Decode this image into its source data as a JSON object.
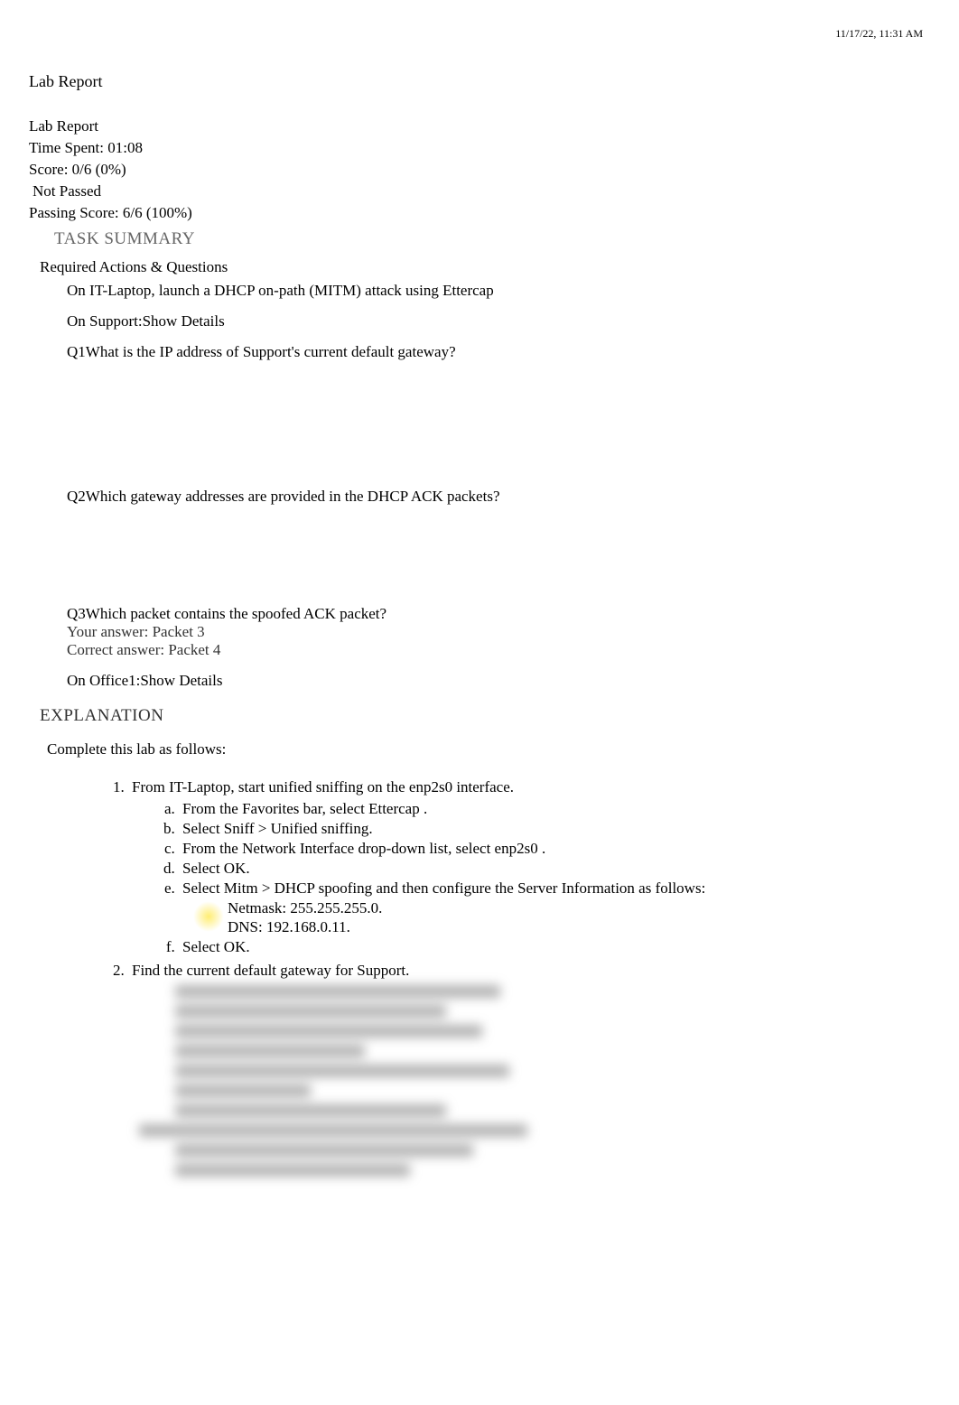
{
  "header": {
    "timestamp": "11/17/22, 11:31 AM"
  },
  "title": "Lab Report",
  "meta": {
    "report_label": "Lab Report",
    "time_spent": "Time Spent: 01:08",
    "score": "Score: 0/6 (0%)",
    "status": "Not Passed",
    "passing_score": "Passing Score: 6/6 (100%)"
  },
  "task_summary_heading": "TASK SUMMARY",
  "required_heading": "Required Actions & Questions",
  "tasks": {
    "t1": "On IT-Laptop, launch a DHCP on-path (MITM) attack using Ettercap",
    "t2": "On Support:Show Details",
    "q1_label": "Q1",
    "q1_text": "What is the IP address of Support's current default gateway?",
    "q2_label": "Q2",
    "q2_text": "Which gateway addresses are provided in the DHCP ACK packets?",
    "q3_label": "Q3",
    "q3_text": "Which packet contains the spoofed ACK packet?",
    "q3_your": "Your answer: Packet 3",
    "q3_correct": "Correct answer: Packet 4",
    "t3": "On Office1:Show Details"
  },
  "explanation_heading": "EXPLANATION",
  "complete_line": "Complete this lab as follows:",
  "steps": {
    "s1": {
      "text": "From IT-Laptop, start unified sniffing on the enp2s0 interface.",
      "a": "From the Favorites bar, select Ettercap .",
      "b": " Select Sniff > Unified sniffing.",
      "c": "From the Network Interface drop-down list, select enp2s0 .",
      "d": " Select OK.",
      "e": " Select Mitm > DHCP spoofing  and then configure the Server Information as follows:",
      "e_sub1": "Netmask: 255.255.255.0.",
      "e_sub2": "DNS: 192.168.0.11.",
      "f": " Select OK."
    },
    "s2": {
      "text": "Find the current default gateway for Support."
    }
  }
}
